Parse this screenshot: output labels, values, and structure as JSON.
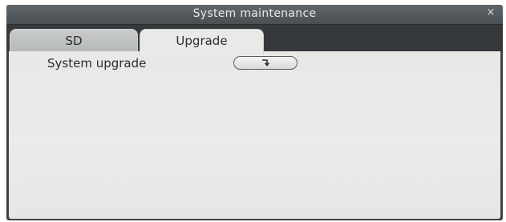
{
  "window": {
    "title": "System maintenance",
    "close_glyph": "×"
  },
  "tabs": [
    {
      "label": "SD",
      "active": false
    },
    {
      "label": "Upgrade",
      "active": true
    }
  ],
  "upgrade_panel": {
    "system_upgrade_label": "System upgrade",
    "upgrade_button_icon": "enter-icon"
  },
  "colors": {
    "title_bar": "#55595d",
    "tab_strip": "#35393c",
    "panel_background": "#e9e9e7",
    "text": "#2c2c2c"
  }
}
